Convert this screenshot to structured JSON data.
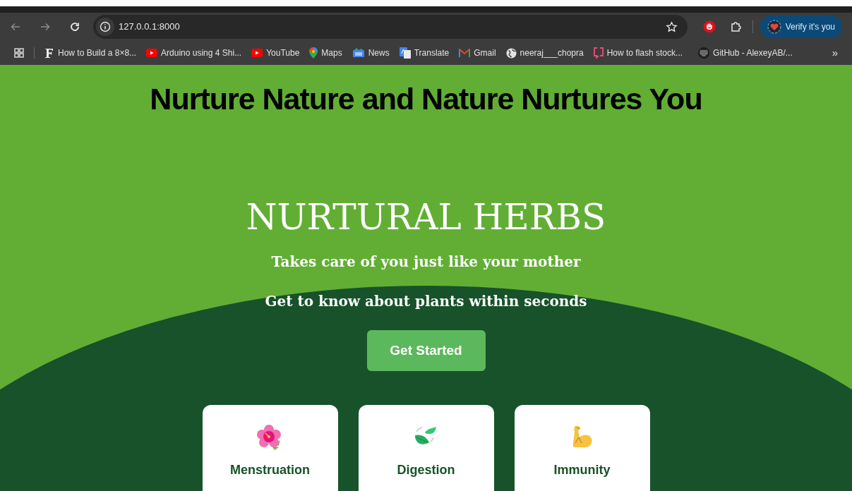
{
  "browser": {
    "url": "127.0.0.1:8000",
    "profile_button": "Verify it's you",
    "bookmarks": [
      {
        "kind": "font",
        "label": "How to Build a 8×8..."
      },
      {
        "kind": "youtube",
        "label": "Arduino using 4 Shi..."
      },
      {
        "kind": "youtube",
        "label": "YouTube"
      },
      {
        "kind": "maps",
        "label": "Maps"
      },
      {
        "kind": "news",
        "label": "News"
      },
      {
        "kind": "translate",
        "label": "Translate"
      },
      {
        "kind": "gmail",
        "label": "Gmail"
      },
      {
        "kind": "globe",
        "label": "neeraj___chopra"
      },
      {
        "kind": "flash",
        "label": "How to flash stock..."
      },
      {
        "kind": "github",
        "label": "GitHub - AlexeyAB/..."
      }
    ],
    "more": "»"
  },
  "page": {
    "tagline": "Nurture Nature and Nature Nurtures You",
    "title": "NURTURAL HERBS",
    "subtitles": [
      "Takes care of you just like your mother",
      "Get to know about plants within seconds"
    ],
    "cta": "Get Started",
    "cards": [
      {
        "kind": "flower",
        "label": "Menstruation"
      },
      {
        "kind": "leaves",
        "label": "Digestion"
      },
      {
        "kind": "muscle",
        "label": "Immunity"
      }
    ]
  }
}
